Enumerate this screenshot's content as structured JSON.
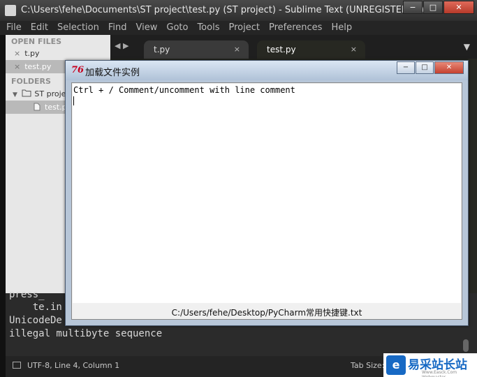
{
  "window": {
    "title": "C:\\Users\\fehe\\Documents\\ST project\\test.py (ST project) - Sublime Text (UNREGISTERED)",
    "controls": {
      "minimize": "−",
      "maximize": "□",
      "close": "✕"
    }
  },
  "menu": [
    "File",
    "Edit",
    "Selection",
    "Find",
    "View",
    "Goto",
    "Tools",
    "Project",
    "Preferences",
    "Help"
  ],
  "sidebar": {
    "open_files_header": "OPEN FILES",
    "open_files": [
      {
        "close": "×",
        "name": "t.py"
      },
      {
        "close": "×",
        "name": "test.py"
      }
    ],
    "folders_header": "FOLDERS",
    "folder": {
      "toggle": "▼",
      "name": "ST proje"
    },
    "folder_file": "test.py"
  },
  "tabs": {
    "arrows": "◀ ▶",
    "items": [
      {
        "label": "t.py",
        "close": "×"
      },
      {
        "label": "test.py",
        "close": "×"
      }
    ],
    "menu_icon": "▼"
  },
  "console": {
    "lines": [
      "press_",
      "    te.in",
      "UnicodeDe",
      "illegal multibyte sequence"
    ]
  },
  "statusbar": {
    "position": "UTF-8, Line 4, Column 1",
    "tab_size": "Tab Size:"
  },
  "watermark": {
    "logo": "e",
    "text": "易采站长站",
    "sub": "Www.Easck.Com Webmaster"
  },
  "dialog": {
    "icon": "76",
    "title": "加载文件实例",
    "controls": {
      "minimize": "−",
      "maximize": "□",
      "close": "✕"
    },
    "text": "Ctrl + / Comment/uncomment with line comment",
    "status": "C:/Users/fehe/Desktop/PyCharm常用快捷键.txt"
  },
  "colors": {
    "sidebar_bg": "#e7e7e7",
    "editor_bg": "#272822",
    "dialog_frame": "#b7c6d8",
    "watermark_blue": "#1769c4"
  }
}
